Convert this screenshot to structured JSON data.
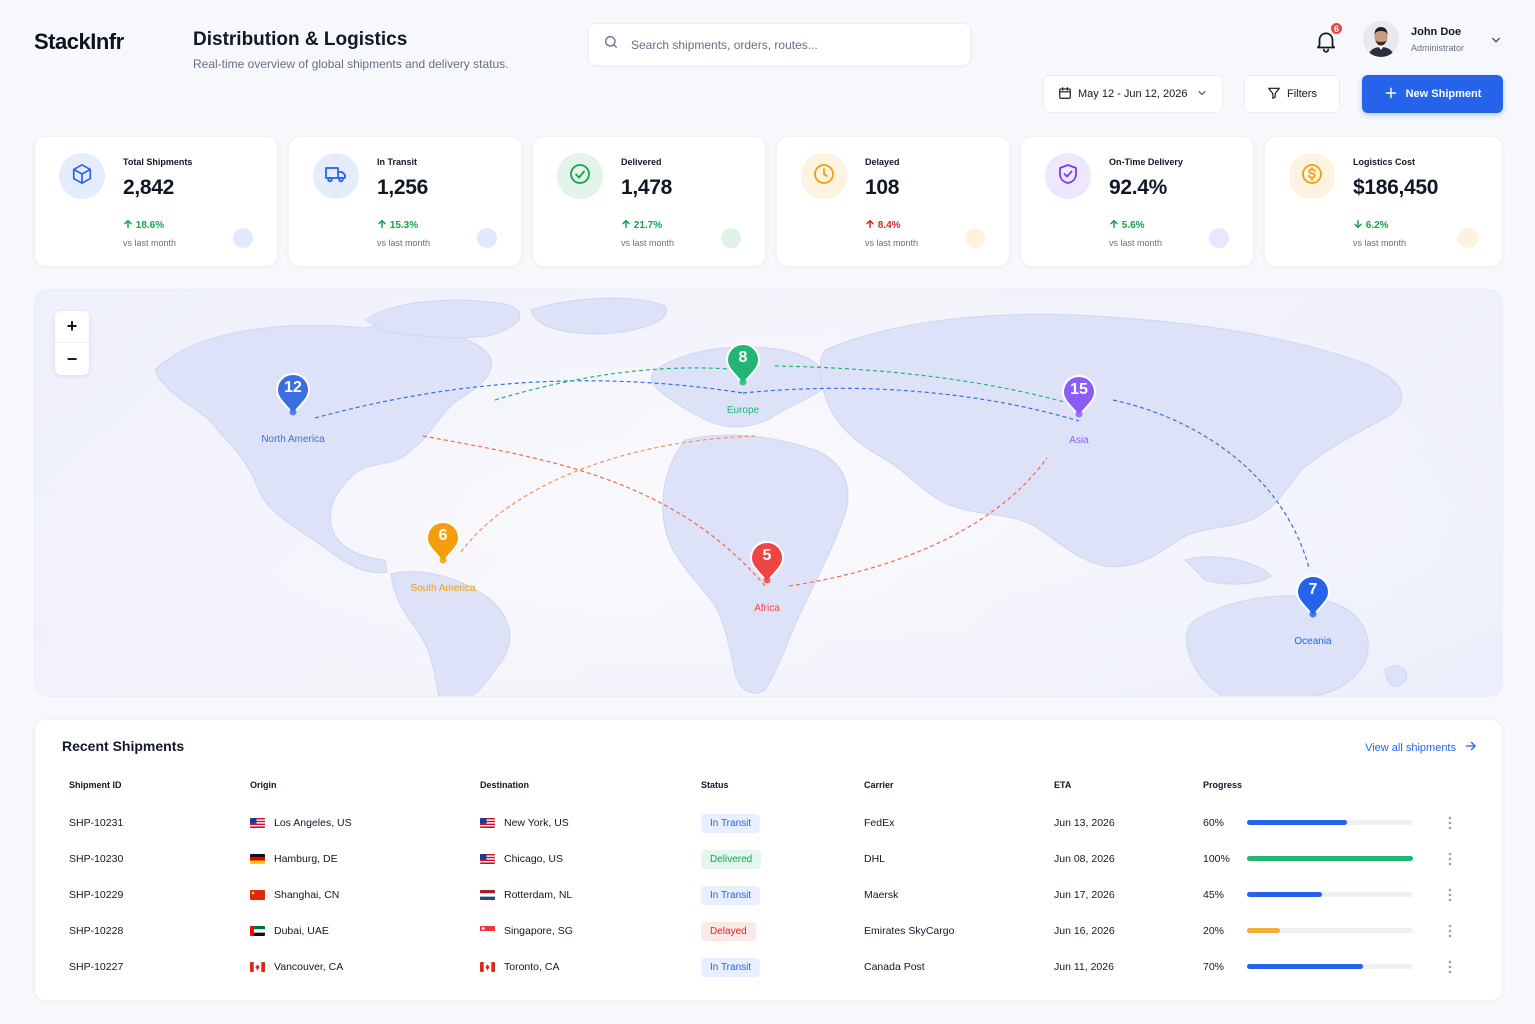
{
  "brand": {
    "logo": "StackInfr"
  },
  "header": {
    "title": "Distribution & Logistics",
    "subtitle": "Real-time overview of global shipments and delivery status.",
    "search_placeholder": "Search shipments, orders, routes...",
    "notifications_count": "6",
    "user": {
      "name": "John Doe",
      "role": "Administrator"
    }
  },
  "toolbar": {
    "date_range": "May 12 - Jun 12, 2026",
    "filters_label": "Filters",
    "new_shipment_label": "New Shipment"
  },
  "kpis": [
    {
      "label": "Total Shipments",
      "value": "2,842",
      "change": "18.6%",
      "direction": "up",
      "sentiment": "positive",
      "vs": "vs last month",
      "icon": "package-icon",
      "color": "#2563eb"
    },
    {
      "label": "In Transit",
      "value": "1,256",
      "change": "15.3%",
      "direction": "up",
      "sentiment": "positive",
      "vs": "vs last month",
      "icon": "truck-icon",
      "color": "#2563eb"
    },
    {
      "label": "Delivered",
      "value": "1,478",
      "change": "21.7%",
      "direction": "up",
      "sentiment": "positive",
      "vs": "vs last month",
      "icon": "check-circle-icon",
      "color": "#16a34a"
    },
    {
      "label": "Delayed",
      "value": "108",
      "change": "8.4%",
      "direction": "up",
      "sentiment": "negative",
      "vs": "vs last month",
      "icon": "clock-icon",
      "color": "#f59e0b"
    },
    {
      "label": "On-Time Delivery",
      "value": "92.4%",
      "change": "5.6%",
      "direction": "up",
      "sentiment": "positive",
      "vs": "vs last month",
      "icon": "shield-check-icon",
      "color": "#7c3aed"
    },
    {
      "label": "Logistics Cost",
      "value": "$186,450",
      "change": "6.2%",
      "direction": "down",
      "sentiment": "positive",
      "vs": "vs last month",
      "icon": "dollar-coin-icon",
      "color": "#f59e0b"
    }
  ],
  "map": {
    "zoom_in": "+",
    "zoom_out": "−",
    "regions": [
      {
        "name": "North America",
        "count": "12",
        "color": "#3b6fe0"
      },
      {
        "name": "Europe",
        "count": "8",
        "color": "#22b573"
      },
      {
        "name": "Asia",
        "count": "15",
        "color": "#8b5cf6"
      },
      {
        "name": "South America",
        "count": "6",
        "color": "#f59e0b"
      },
      {
        "name": "Africa",
        "count": "5",
        "color": "#ef4444"
      },
      {
        "name": "Oceania",
        "count": "7",
        "color": "#2563eb"
      }
    ]
  },
  "shipments": {
    "title": "Recent Shipments",
    "view_all": "View all shipments",
    "columns": [
      "Shipment ID",
      "Origin",
      "Destination",
      "Status",
      "Carrier",
      "ETA",
      "Progress"
    ],
    "rows": [
      {
        "id": "SHP-10231",
        "origin": "Los Angeles, US",
        "origin_flag": "us",
        "destination": "New York, US",
        "destination_flag": "us",
        "status": "In Transit",
        "status_kind": "transit",
        "carrier": "FedEx",
        "eta": "Jun 13, 2026",
        "progress": "60%",
        "progress_value": 0.6,
        "bar_color": "#2563eb"
      },
      {
        "id": "SHP-10230",
        "origin": "Hamburg, DE",
        "origin_flag": "de",
        "destination": "Chicago, US",
        "destination_flag": "us",
        "status": "Delivered",
        "status_kind": "delivered",
        "carrier": "DHL",
        "eta": "Jun 08, 2026",
        "progress": "100%",
        "progress_value": 1.0,
        "bar_color": "#22b573"
      },
      {
        "id": "SHP-10229",
        "origin": "Shanghai, CN",
        "origin_flag": "cn",
        "destination": "Rotterdam, NL",
        "destination_flag": "nl",
        "status": "In Transit",
        "status_kind": "transit",
        "carrier": "Maersk",
        "eta": "Jun 17, 2026",
        "progress": "45%",
        "progress_value": 0.45,
        "bar_color": "#2563eb"
      },
      {
        "id": "SHP-10228",
        "origin": "Dubai, UAE",
        "origin_flag": "ae",
        "destination": "Singapore, SG",
        "destination_flag": "sg",
        "status": "Delayed",
        "status_kind": "delayed",
        "carrier": "Emirates SkyCargo",
        "eta": "Jun 16, 2026",
        "progress": "20%",
        "progress_value": 0.2,
        "bar_color": "#f6ad37"
      },
      {
        "id": "SHP-10227",
        "origin": "Vancouver, CA",
        "origin_flag": "ca",
        "destination": "Toronto, CA",
        "destination_flag": "ca",
        "status": "In Transit",
        "status_kind": "transit",
        "carrier": "Canada Post",
        "eta": "Jun 11, 2026",
        "progress": "70%",
        "progress_value": 0.7,
        "bar_color": "#2563eb"
      }
    ]
  }
}
